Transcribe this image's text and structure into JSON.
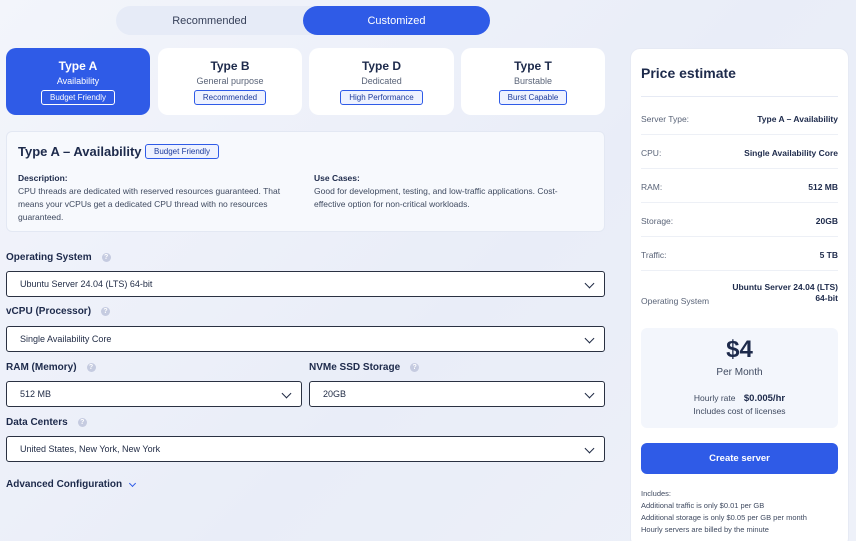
{
  "mode_toggle": {
    "recommended": "Recommended",
    "customized": "Customized"
  },
  "types": [
    {
      "title": "Type A",
      "subtitle": "Availability",
      "badge": "Budget Friendly"
    },
    {
      "title": "Type B",
      "subtitle": "General purpose",
      "badge": "Recommended"
    },
    {
      "title": "Type D",
      "subtitle": "Dedicated",
      "badge": "High Performance"
    },
    {
      "title": "Type T",
      "subtitle": "Burstable",
      "badge": "Burst Capable"
    }
  ],
  "description": {
    "title": "Type A – Availability",
    "badge": "Budget Friendly",
    "desc_header": "Description:",
    "desc_line1": "CPU threads are dedicated with reserved resources guaranteed. That",
    "desc_line2": "means your vCPUs get a dedicated CPU thread with no resources",
    "desc_line3": "guaranteed.",
    "use_header": "Use Cases:",
    "use_line1": "Good for development, testing, and low-traffic applications. Cost-",
    "use_line2": "effective option for non-critical workloads."
  },
  "form": {
    "os_label": "Operating System",
    "os_value": "Ubuntu Server 24.04 (LTS) 64-bit",
    "cpu_label": "vCPU (Processor)",
    "cpu_value": "Single Availability Core",
    "ram_label": "RAM (Memory)",
    "ram_value": "512 MB",
    "storage_label": "NVMe SSD Storage",
    "storage_value": "20GB",
    "dc_label": "Data Centers",
    "dc_value": "United States, New York, New York",
    "help": "?",
    "advanced": "Advanced Configuration"
  },
  "price": {
    "title": "Price estimate",
    "rows": [
      {
        "k": "Server Type:",
        "v": "Type A – Availability"
      },
      {
        "k": "CPU:",
        "v": "Single Availability Core"
      },
      {
        "k": "RAM:",
        "v": "512 MB"
      },
      {
        "k": "Storage:",
        "v": "20GB"
      },
      {
        "k": "Traffic:",
        "v": "5 TB"
      }
    ],
    "os_key": "Operating System",
    "os_val1": "Ubuntu Server 24.04 (LTS)",
    "os_val2": "64-bit",
    "amount": "$4",
    "period": "Per Month",
    "hourly_label": "Hourly rate",
    "hourly_value": "$0.005/hr",
    "licenses": "Includes cost of licenses",
    "create": "Create server",
    "includes_header": "Includes:",
    "includes_1": "Additional traffic is only $0.01 per GB",
    "includes_2": "Additional storage is only $0.05 per GB per month",
    "includes_3": "Hourly servers are billed by the minute"
  },
  "colors": {
    "accent": "#2f5be7",
    "text": "#1d2a4b"
  }
}
